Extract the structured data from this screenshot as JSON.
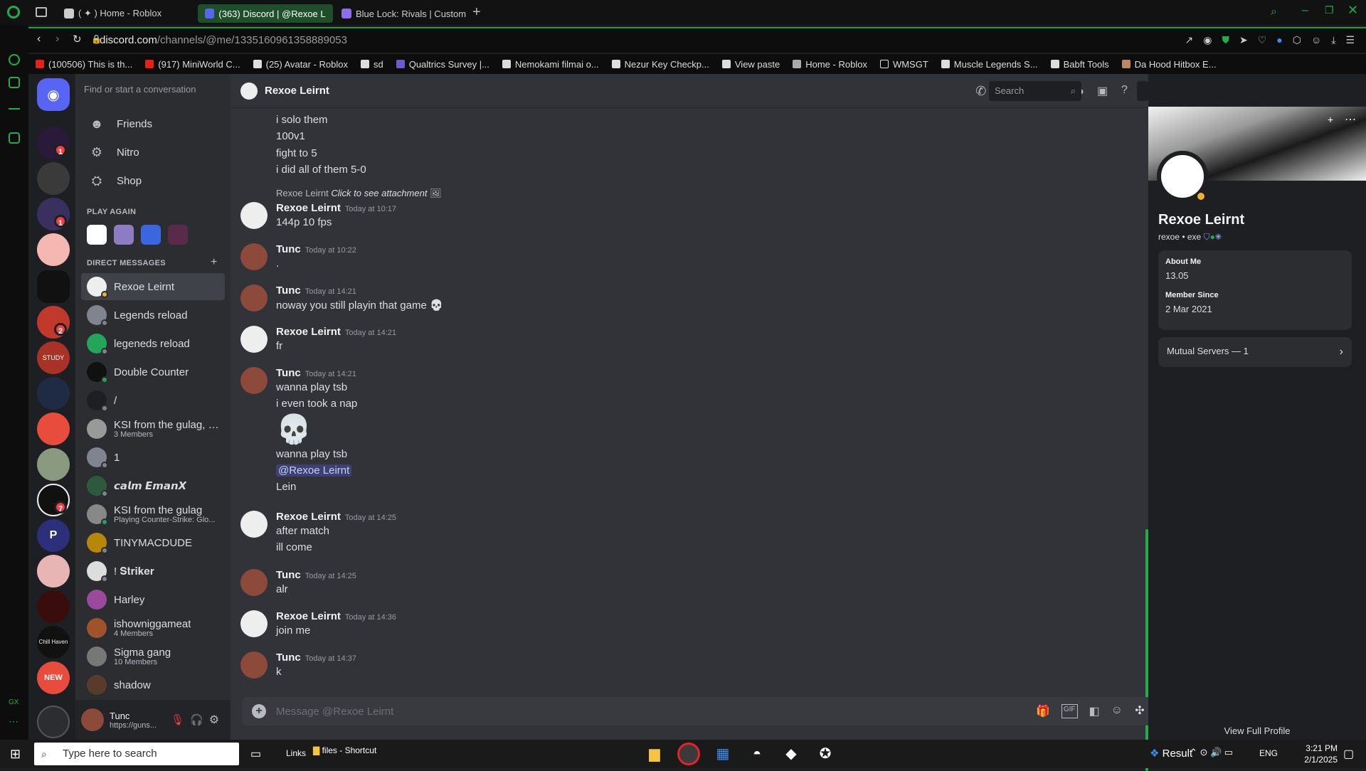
{
  "browser": {
    "tabs": [
      {
        "label": "( ✦ ) Home - Roblox",
        "active": false
      },
      {
        "label": "(363) Discord | @Rexoe Le",
        "active": true
      },
      {
        "label": "Blue Lock: Rivals | Custom",
        "active": false
      }
    ],
    "url_host": "discord.com",
    "url_path": "/channels/@me/1335160961358889053",
    "bookmarks": [
      "(100506) This is th...",
      "(917) MiniWorld C...",
      "(25) Avatar - Roblox",
      "sd",
      "Qualtrics Survey |...",
      "Nemokami filmai o...",
      "Nezur Key Checkp...",
      "View paste",
      "Home - Roblox",
      "WMSGT",
      "Muscle Legends S...",
      "Babft Tools",
      "Da Hood Hitbox E..."
    ]
  },
  "servers": {
    "badges": [
      "1",
      "1",
      "2",
      "7"
    ],
    "new_label": "NEW",
    "chill_label": "Chill Haven",
    "chill2_label": "STUDY"
  },
  "sidebar": {
    "search_placeholder": "Find or start a conversation",
    "nav": [
      "Friends",
      "Nitro",
      "Shop"
    ],
    "play_again_label": "PLAY AGAIN",
    "dm_header": "DIRECT MESSAGES",
    "dms": [
      {
        "name": "Rexoe Leirnt",
        "sub": ""
      },
      {
        "name": "Legends reload",
        "sub": ""
      },
      {
        "name": "legeneds reload",
        "sub": ""
      },
      {
        "name": "Double Counter",
        "sub": ""
      },
      {
        "name": "/",
        "sub": ""
      },
      {
        "name": "KSI from the gulag, L...",
        "sub": "3 Members"
      },
      {
        "name": "1",
        "sub": ""
      },
      {
        "name": "𝙘𝙖𝙡𝙢 𝙀𝙢𝙖𝙣𝙓",
        "sub": ""
      },
      {
        "name": "KSI from the gulag",
        "sub": "Playing Counter-Strike: Glo..."
      },
      {
        "name": "TINYMACDUDE",
        "sub": ""
      },
      {
        "name": "! 𝐒𝐭𝐫𝐢𝐤𝐞𝐫",
        "sub": ""
      },
      {
        "name": "Harley",
        "sub": ""
      },
      {
        "name": "ishowniggameat",
        "sub": "4 Members"
      },
      {
        "name": "Sigma gang",
        "sub": "10 Members"
      },
      {
        "name": "shadow",
        "sub": ""
      }
    ],
    "user": {
      "name": "Tunc",
      "status": "https://guns..."
    }
  },
  "chat": {
    "title": "Rexoe Leirnt",
    "search_placeholder": "Search",
    "reply_preview": {
      "author": "Rexoe Leirnt",
      "text": "Click to see attachment"
    },
    "top_lines": [
      "i solo them",
      "100v1",
      "fight to 5",
      "i did all of them 5-0"
    ],
    "messages": [
      {
        "author": "Rexoe Leirnt",
        "time": "Today at 10:17",
        "lines": [
          "144p 10 fps"
        ]
      },
      {
        "author": "Tunc",
        "time": "Today at 10:22",
        "lines": [
          "."
        ]
      },
      {
        "author": "Tunc",
        "time": "Today at 14:21",
        "lines": [
          "noway you still playin that game 💀"
        ]
      },
      {
        "author": "Rexoe Leirnt",
        "time": "Today at 14:21",
        "lines": [
          "fr"
        ]
      },
      {
        "author": "Tunc",
        "time": "Today at 14:21",
        "lines": [
          "wanna play tsb",
          "i even took a nap",
          "💀",
          "wanna play tsb",
          "@Rexoe Leirnt",
          "Lein"
        ]
      },
      {
        "author": "Rexoe Leirnt",
        "time": "Today at 14:25",
        "lines": [
          "after match",
          "ill come"
        ]
      },
      {
        "author": "Tunc",
        "time": "Today at 14:25",
        "lines": [
          "alr"
        ]
      },
      {
        "author": "Rexoe Leirnt",
        "time": "Today at 14:36",
        "lines": [
          "join me"
        ]
      },
      {
        "author": "Tunc",
        "time": "Today at 14:37",
        "lines": [
          "k"
        ]
      }
    ],
    "composer_placeholder": "Message @Rexoe Leirnt"
  },
  "profile": {
    "name": "Rexoe Leirnt",
    "handle": "rexoe • exe",
    "about_label": "About Me",
    "about_value": "13.05",
    "member_since_label": "Member Since",
    "member_since_value": "2 Mar 2021",
    "mutual_servers": "Mutual Servers — 1",
    "view_full": "View Full Profile"
  },
  "taskbar": {
    "search_placeholder": "Type here to search",
    "links_label": "Links",
    "shortcut_label": "files - Shortcut",
    "weather_label": "Result",
    "lang": "ENG",
    "time": "3:21 PM",
    "date": "2/1/2025"
  },
  "colors": {
    "accent": "#5865f2",
    "opera_green": "#1fae4b",
    "badge_red": "#f23f43",
    "online": "#23a55a"
  }
}
